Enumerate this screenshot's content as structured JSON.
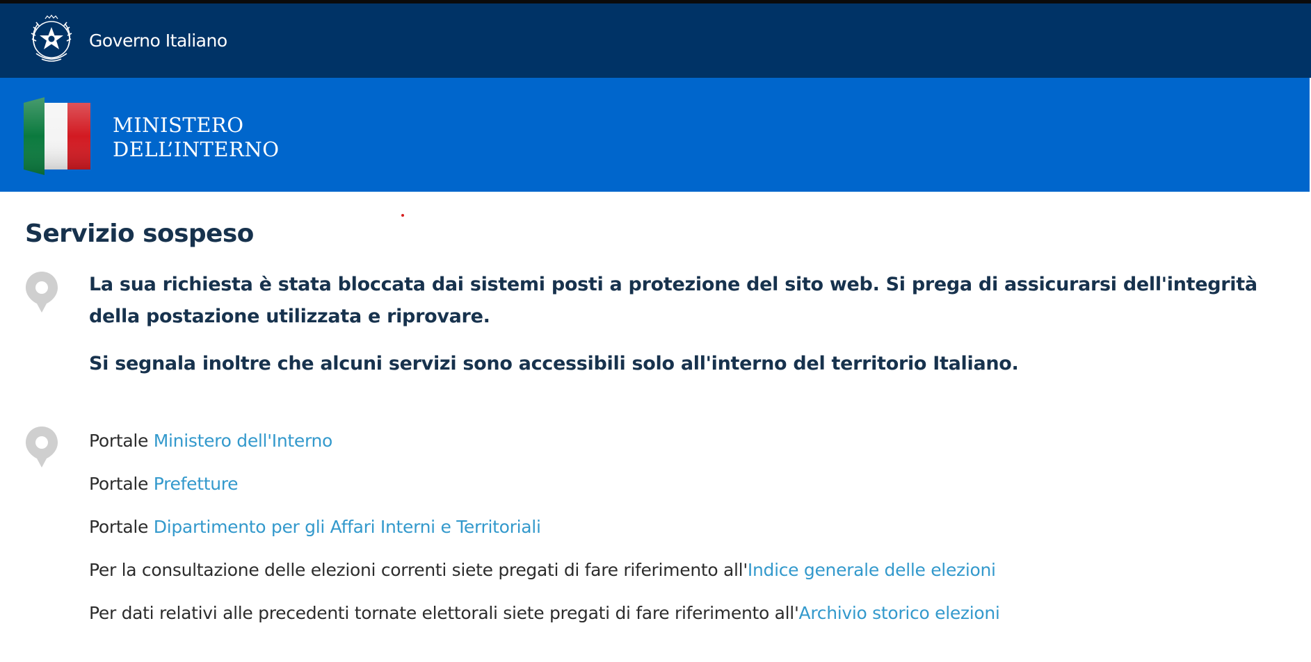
{
  "header": {
    "gov_title": "Governo Italiano",
    "ministry_line1": "MINISTERO",
    "ministry_line2": "DELL’INTERNO"
  },
  "main": {
    "title": "Servizio sospeso",
    "notice": [
      "La sua richiesta è stata bloccata dai sistemi posti a protezione del sito web. Si prega di assicurarsi dell'integrità della postazione utilizzata e riprovare.",
      "Si segnala inoltre che alcuni servizi sono accessibili solo all'interno del territorio Italiano."
    ],
    "links": [
      {
        "prefix": "Portale ",
        "link": "Ministero dell'Interno"
      },
      {
        "prefix": "Portale ",
        "link": "Prefetture"
      },
      {
        "prefix": "Portale ",
        "link": "Dipartimento per gli Affari Interni e Territoriali"
      },
      {
        "prefix": "Per la consultazione delle elezioni correnti siete pregati di fare riferimento all'",
        "link": "Indice generale delle elezioni"
      },
      {
        "prefix": "Per dati relativi alle precedenti tornate elettorali siete pregati di fare riferimento all'",
        "link": "Archivio storico elezioni"
      }
    ]
  },
  "colors": {
    "gov_bar": "#003366",
    "ministry_bar": "#0066cc",
    "title_text": "#17324d",
    "link": "#3399cc"
  },
  "icons": {
    "emblem": "italian-republic-emblem-icon",
    "flag": "italian-flag-icon",
    "pin": "map-pin-icon"
  }
}
